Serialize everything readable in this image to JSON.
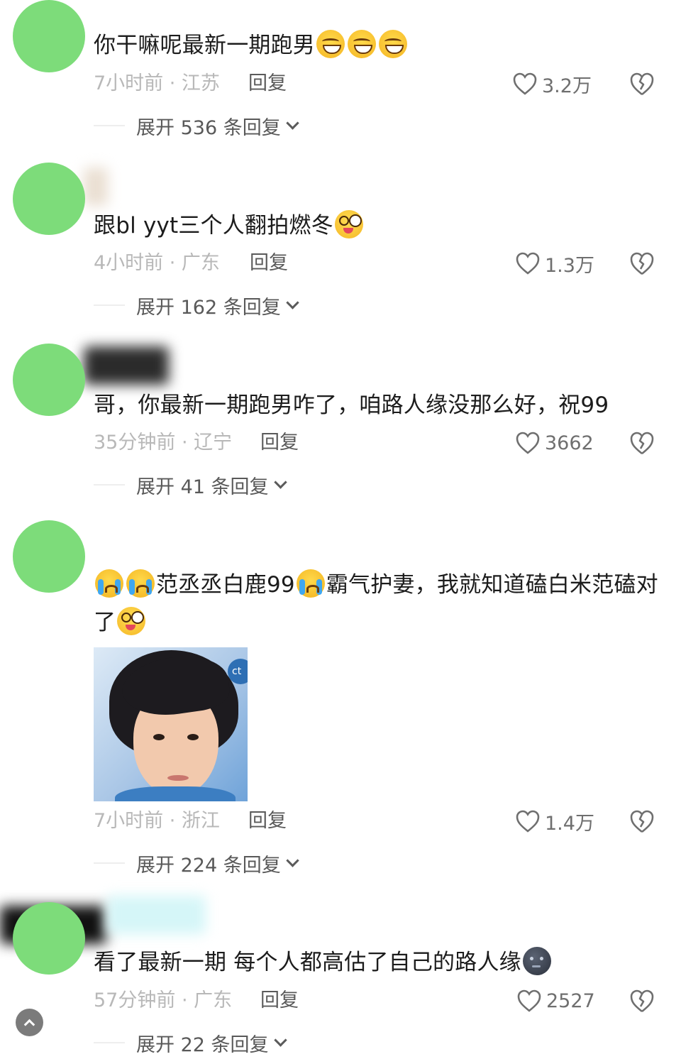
{
  "comments": [
    {
      "text": "你干嘛呢最新一期跑男",
      "emojis": [
        "grin-emoji",
        "grin-emoji",
        "grin-emoji"
      ],
      "time_location": "7小时前 · 江苏",
      "reply_label": "回复",
      "likes": "3.2万",
      "expand_label": "展开 536 条回复"
    },
    {
      "text": "跟bl yyt三个人翻拍燃冬",
      "emojis": [
        "dizzy-emoji"
      ],
      "time_location": "4小时前 · 广东",
      "reply_label": "回复",
      "likes": "1.3万",
      "expand_label": "展开 162 条回复"
    },
    {
      "text": "哥，你最新一期跑男咋了，咱路人缘没那么好，祝99",
      "time_location": "35分钟前 · 辽宁",
      "reply_label": "回复",
      "likes": "3662",
      "expand_label": "展开 41 条回复"
    },
    {
      "text_part1": "范丞丞白鹿99",
      "text_part2": "霸气护妻，我就知道磕白米范磕对了",
      "emojis": [
        "cry-emoji",
        "cry-emoji",
        "cry-emoji",
        "dizzy-emoji"
      ],
      "image": "reaction-photo",
      "photo_logo": "ct",
      "time_location": "7小时前 · 浙江",
      "reply_label": "回复",
      "likes": "1.4万",
      "expand_label": "展开 224 条回复"
    },
    {
      "text": "看了最新一期 每个人都高估了自己的路人缘",
      "emojis": [
        "moon-emoji"
      ],
      "time_location": "57分钟前 · 广东",
      "reply_label": "回复",
      "likes": "2527",
      "expand_label": "展开 22 条回复"
    }
  ],
  "colors": {
    "avatar": "#7ddc7a",
    "meta_text": "#b8b8b8",
    "body_text": "#1c1c1c"
  },
  "icons": [
    "heart-outline-icon",
    "broken-heart-icon",
    "chevron-down-icon",
    "chevron-up-icon"
  ]
}
